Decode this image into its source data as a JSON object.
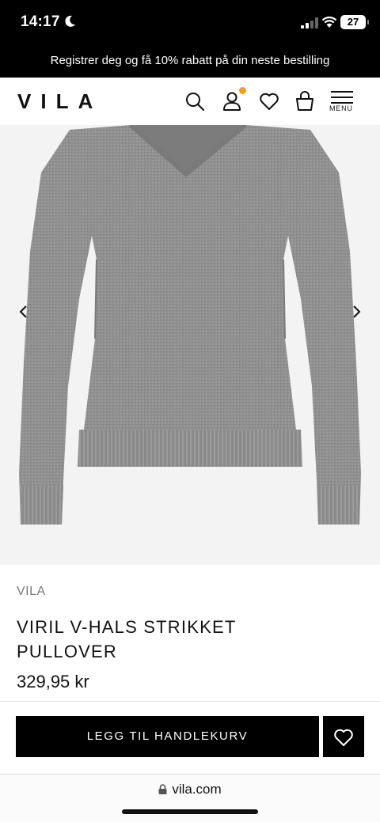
{
  "status_bar": {
    "time": "14:17",
    "battery": "27"
  },
  "promo": {
    "text": "Registrer deg og få 10% rabatt på din neste bestilling"
  },
  "header": {
    "logo": "VILA",
    "menu_label": "MENU",
    "icons": [
      "search-icon",
      "account-icon",
      "heart-icon",
      "bag-icon",
      "menu-icon"
    ],
    "notification_color": "#f39c1f"
  },
  "gallery": {
    "product_color": "#8e8e8e",
    "background": "#f3f3f3"
  },
  "product": {
    "brand": "VILA",
    "title": "VIRIL V-HALS STRIKKET PULLOVER",
    "price": "329,95 kr"
  },
  "actions": {
    "add_to_cart": "LEGG TIL HANDLEKURV"
  },
  "browser": {
    "url": "vila.com"
  }
}
